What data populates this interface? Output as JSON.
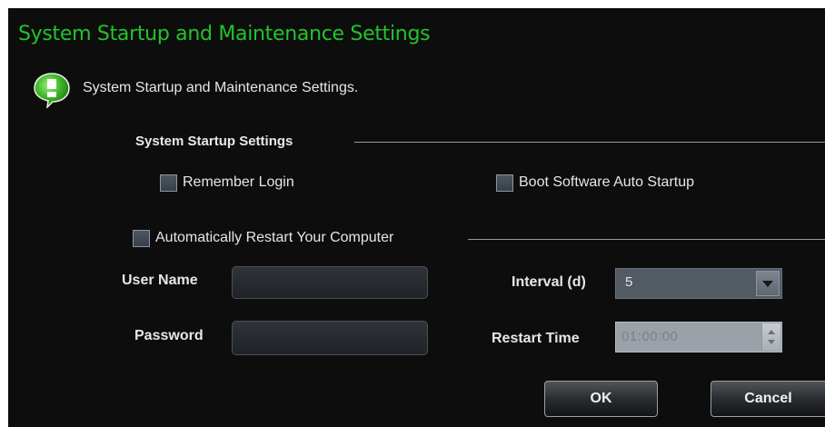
{
  "window": {
    "title": "System Startup and Maintenance Settings"
  },
  "info": {
    "icon": "info-bubble-icon",
    "text": "System Startup and Maintenance Settings.",
    "accent_color": "#22c42a"
  },
  "startup": {
    "section_label": "System Startup Settings",
    "remember_login_label": "Remember Login",
    "remember_login_checked": false,
    "boot_auto_startup_label": "Boot Software Auto Startup",
    "boot_auto_startup_checked": false
  },
  "restart": {
    "auto_restart_label": "Automatically Restart Your Computer",
    "auto_restart_checked": false,
    "user_name_label": "User Name",
    "user_name_value": "",
    "password_label": "Password",
    "password_value": "",
    "interval_label": "Interval (d)",
    "interval_value": "5",
    "restart_time_label": "Restart Time",
    "restart_time_value": "01:00:00"
  },
  "buttons": {
    "ok_label": "OK",
    "cancel_label": "Cancel"
  }
}
